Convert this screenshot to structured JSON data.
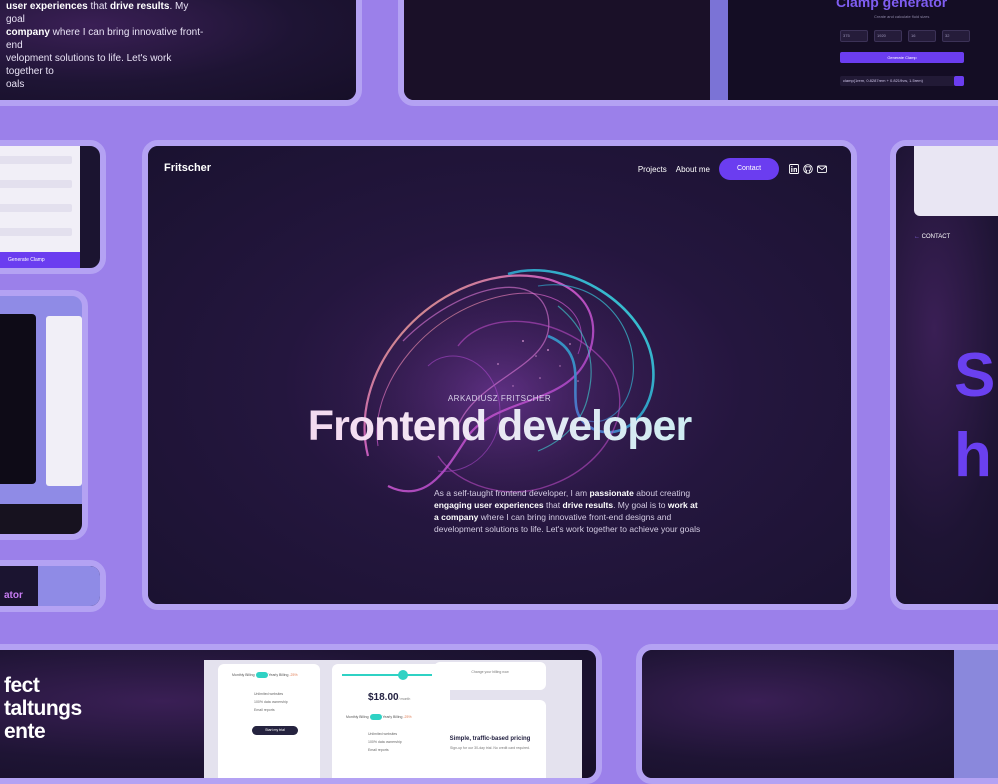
{
  "main": {
    "logo": "Fritscher",
    "nav": {
      "projects": "Projects",
      "about": "About me",
      "contact": "Contact"
    },
    "social_icons": [
      "linkedin-icon",
      "github-icon",
      "mail-icon"
    ],
    "eyebrow": "ARKADIUSZ FRITSCHER",
    "headline": "Frontend developer",
    "intro_parts": [
      "As a self-taught frontend developer, I am ",
      "passionate",
      " about creating ",
      "engaging user experiences",
      " that ",
      "drive results",
      ". My goal is to ",
      "work at a company",
      " where I can bring innovative front-end designs and development solutions to life. Let's work together to achieve your goals"
    ]
  },
  "top_left": {
    "lines_parts": [
      "user experiences",
      " that ",
      "drive results",
      ". My goal"
    ],
    "line2_parts": [
      "company",
      " where I can bring innovative front-end"
    ],
    "line3": "velopment solutions to life. Let's work together to",
    "line4": "oals"
  },
  "top_right": {
    "title": "Clamp generator",
    "subtitle": "Create and calculate fluid sizes",
    "fields": [
      "375",
      "1920",
      "16",
      "32"
    ],
    "button": "Generate Clamp",
    "code": "clamp(1rem, 0.8287rem + 0.8219vw, 1.5rem)"
  },
  "left_cards": {
    "generate_button": "Generate Clamp",
    "bottom_label": "ator"
  },
  "right_card": {
    "contact_arrow": "←",
    "contact_label": "CONTACT",
    "big_letters": [
      "S",
      "h"
    ]
  },
  "bottom_left": {
    "lines": [
      "fect",
      "taltungs",
      "ente"
    ],
    "monthly": "Monthly Billing",
    "yearly": "Yearly Billing",
    "discount": "-25%",
    "features": [
      "Unlimited websites",
      "100% data ownership",
      "Email reports"
    ],
    "start_button": "Start my trial",
    "price": "$18.00",
    "price_unit": "/ month",
    "change_note": "Change your billing now",
    "simple_pricing": "Simple, traffic-based pricing",
    "signup_note": "Sign-up for our 30-day trial. No credit card required."
  },
  "colors": {
    "background": "#9b80ea",
    "accent": "#6b3df0",
    "card_border": "#b4a2f3",
    "dark_bg": "#1c1330"
  }
}
